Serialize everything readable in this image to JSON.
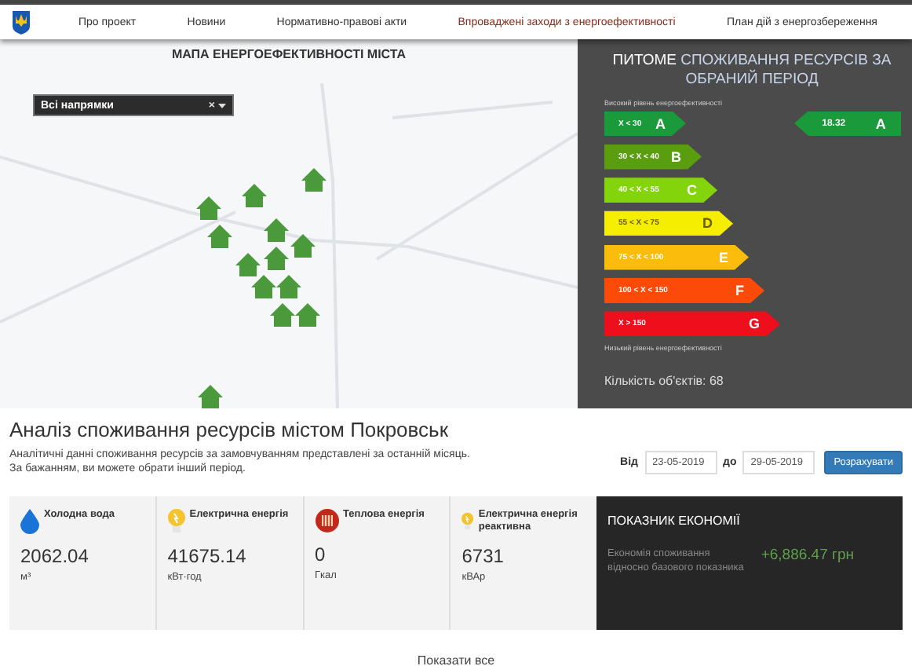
{
  "nav": {
    "items": [
      {
        "label": "Про проект",
        "selected": false
      },
      {
        "label": "Новини",
        "selected": false
      },
      {
        "label": "Нормативно-правові акти",
        "selected": false
      },
      {
        "label": "Впроваджені заходи з енергоефективності",
        "selected": true
      },
      {
        "label": "План дій з енергозбереження",
        "selected": false
      }
    ]
  },
  "map": {
    "title": "МАПА ЕНЕРГОЕФЕКТИВНОСТІ МІСТА",
    "filter": {
      "value": "Всі напрямки",
      "clear": "×"
    }
  },
  "rating": {
    "title_lead": "ПИТОМЕ",
    "title_rest": "СПОЖИВАННЯ РЕСУРСІВ ЗА ОБРАНИЙ ПЕРІОД",
    "top_note": "Високий рівень енергоефективності",
    "classes": [
      {
        "range": "X < 30",
        "letter": "A",
        "color": "#1a9a3a"
      },
      {
        "range": "30 < X < 40",
        "letter": "B",
        "color": "#5a9e10"
      },
      {
        "range": "40 < X < 55",
        "letter": "C",
        "color": "#84d40c"
      },
      {
        "range": "55 < X < 75",
        "letter": "D",
        "color": "#f5ee00"
      },
      {
        "range": "75 < X < 100",
        "letter": "E",
        "color": "#fcbc0c"
      },
      {
        "range": "100 < X < 150",
        "letter": "F",
        "color": "#fc4a08"
      },
      {
        "range": "X > 150",
        "letter": "G",
        "color": "#ee0e1c"
      }
    ],
    "bottom_note": "Низький рівень енергоефективності",
    "current": {
      "value": "18.32",
      "letter": "A",
      "color": "#1a9a3a"
    },
    "count": "Кількість об'єктів: 68"
  },
  "analysis": {
    "title": "Аналіз споживання ресурсів містом Покровськ",
    "description": "Аналітичні данні споживання ресурсів за замовчуванням представлені за останній місяць. За бажанням, ви можете обрати інший період.",
    "from_label": "Від",
    "from": "23-05-2019",
    "to_label": "до",
    "to": "29-05-2019",
    "button": "Розрахувати"
  },
  "resources": [
    {
      "kind": "water",
      "name": "Холодна вода",
      "value": "2062.04",
      "unit": "м³"
    },
    {
      "kind": "electric",
      "name": "Електрична енергія",
      "value": "41675.14",
      "unit": "кВт·год"
    },
    {
      "kind": "heat",
      "name": "Теплова енергія",
      "value": "0",
      "unit": "Гкал"
    },
    {
      "kind": "electric",
      "name": "Електрична енергія реактивна",
      "value": "6731",
      "unit": "кВАр"
    }
  ],
  "savings": {
    "title": "ПОКАЗНИК ЕКОНОМІЇ",
    "description": "Економія споживання відносно базового показника",
    "value": "+6,886.47 грн"
  },
  "show_all": "Показати все"
}
